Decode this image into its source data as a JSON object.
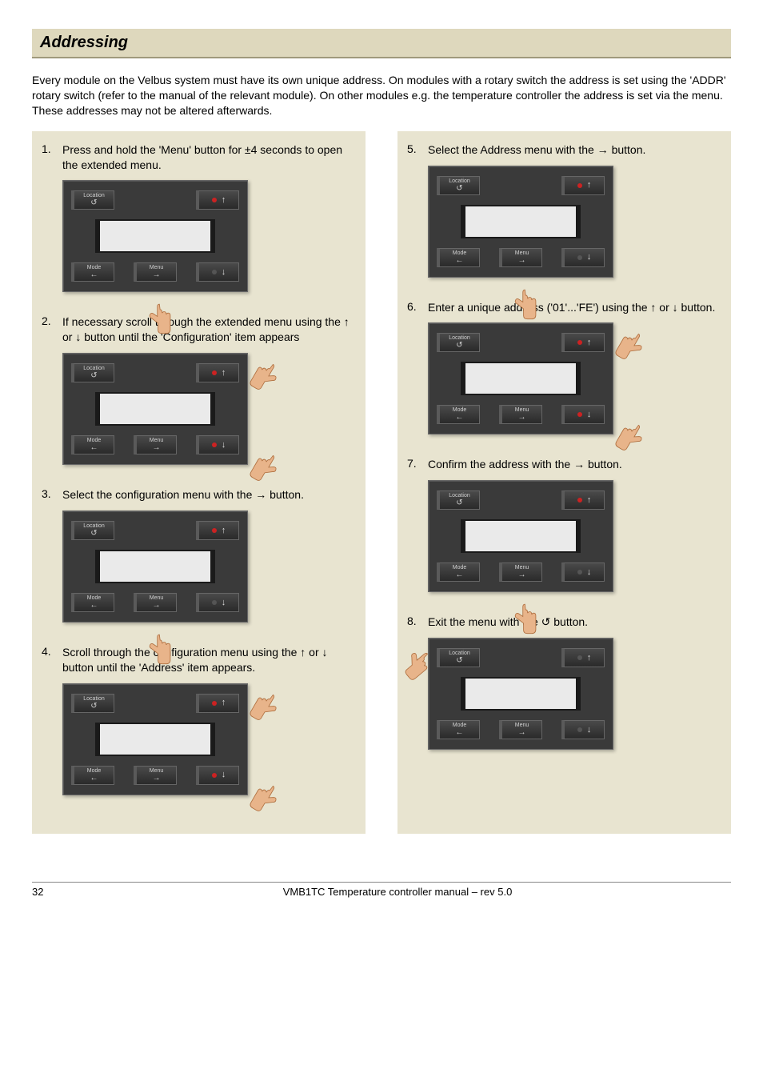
{
  "title": "Addressing",
  "intro": "Every module on the Velbus system must have its own unique address. On modules with a rotary switch the address is set using the 'ADDR' rotary switch (refer to the manual of the relevant module). On other modules e.g. the temperature controller the address is set via the menu. These addresses may not be altered afterwards.",
  "panel_labels": {
    "location": "Location",
    "mode": "Mode",
    "menu": "Menu"
  },
  "steps_left": [
    {
      "num": "1.",
      "text": "Press and hold the 'Menu' button for ±4 seconds to open the extended menu.",
      "hand": "menu"
    },
    {
      "num": "2.",
      "text": "If necessary scroll through the extended menu using the ↑ or ↓ button until the 'Configuration' item appears",
      "hand": "updown"
    },
    {
      "num": "3.",
      "text": "Select the configuration menu with the → button.",
      "hand": "menu"
    },
    {
      "num": "4.",
      "text": "Scroll through the configuration menu using the ↑ or ↓ button until the 'Address' item appears.",
      "hand": "updown"
    }
  ],
  "steps_right": [
    {
      "num": "5.",
      "text": "Select the Address menu with the → button.",
      "hand": "menu"
    },
    {
      "num": "6.",
      "text": "Enter a unique address ('01'...'FE') using the ↑ or ↓ button.",
      "hand": "updown"
    },
    {
      "num": "7.",
      "text": "Confirm the address with the → button.",
      "hand": "menu"
    },
    {
      "num": "8.",
      "text": "Exit the menu with the ↺ button.",
      "hand": "location"
    }
  ],
  "footer": {
    "page": "32",
    "text": "VMB1TC Temperature controller manual – rev 5.0"
  }
}
